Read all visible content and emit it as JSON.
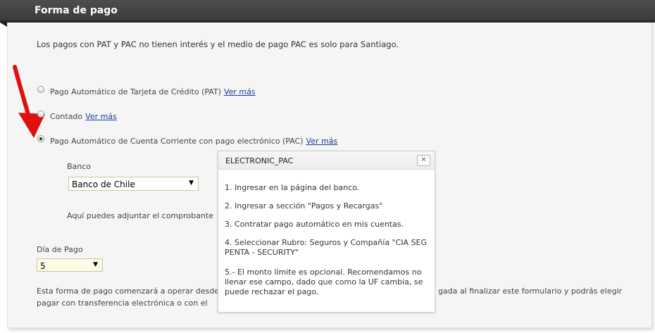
{
  "header": {
    "title": "Forma de pago"
  },
  "intro": "Los pagos con PAT y PAC no tienen interés y el medio de pago PAC es solo para Santiago.",
  "options": [
    {
      "label": "Pago Automático de Tarjeta de Crédito (PAT)",
      "link": "Ver más",
      "checked": false
    },
    {
      "label": "Contado",
      "link": "Ver más",
      "checked": false
    },
    {
      "label": "Pago Automático de Cuenta Corriente con pago electrónico (PAC)",
      "link": "Ver más",
      "checked": true
    }
  ],
  "bank": {
    "label": "Banco",
    "selected": "Banco de Chile"
  },
  "attach_text": "Aquí puedes adjuntar el comprobante",
  "day": {
    "label": "Día de Pago",
    "selected": "5"
  },
  "footer": {
    "line1_left": "Esta forma de pago comenzará a operar desde",
    "line1_right": "gada al finalizar este formulario y podrás elegir",
    "line2_left": "pagar con transferencia electrónica o con el"
  },
  "popup": {
    "title": "ELECTRONIC_PAC",
    "close": "×",
    "steps": [
      "1. Ingresar en la página del banco.",
      "2. Ingresar a sección \"Pagos y Recargas\"",
      "3. Contratar pago automático en mis cuentas.",
      "4. Seleccionar Rubro: Seguros y Compañía \"CIA SEG PENTA - SECURITY\"",
      "5.- El monto límite es opcional. Recomendamos no llenar ese campo, dado que como la UF cambia, se puede rechazar el pago."
    ]
  },
  "colors": {
    "header": "#444444",
    "link": "#1a3a9c",
    "arrow": "#e01010",
    "panel": "#f5f5f5"
  }
}
